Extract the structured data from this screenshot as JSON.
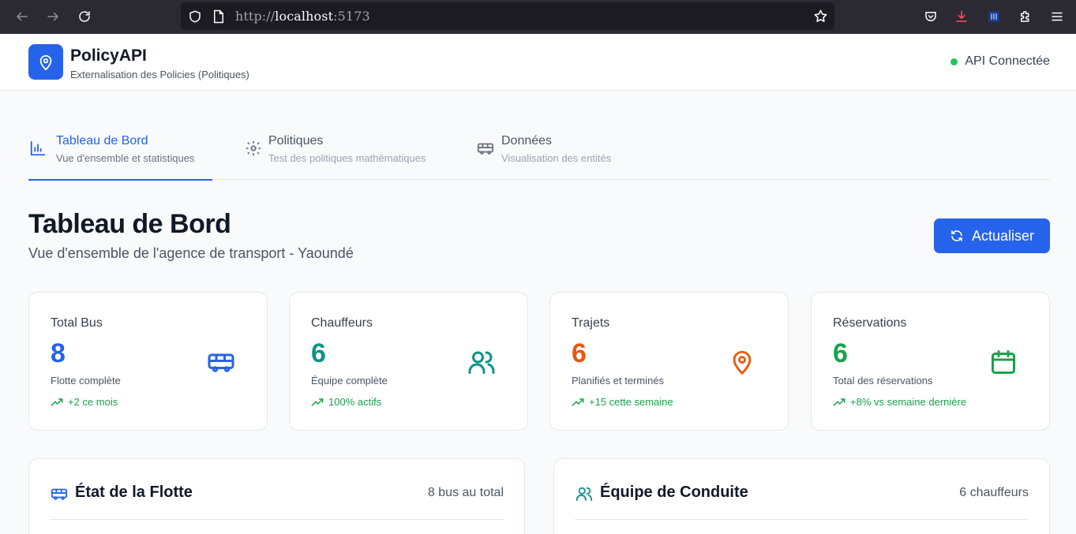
{
  "browser": {
    "url_scheme": "http://",
    "url_host": "localhost",
    "url_port": ":5173"
  },
  "header": {
    "title": "PolicyAPI",
    "subtitle": "Externalisation des Policies (Politiques)",
    "api_status": "API Connectée",
    "status_color": "#22c55e",
    "accent": "#2563eb"
  },
  "tabs": [
    {
      "label": "Tableau de Bord",
      "subtitle": "Vue d'ensemble et statistiques",
      "icon": "bar-chart-icon",
      "active": true
    },
    {
      "label": "Politiques",
      "subtitle": "Test des politiques mathématiques",
      "icon": "gear-icon",
      "active": false
    },
    {
      "label": "Données",
      "subtitle": "Visualisation des entités",
      "icon": "bus-icon",
      "active": false
    }
  ],
  "page": {
    "title": "Tableau de Bord",
    "subtitle": "Vue d'ensemble de l'agence de transport - Yaoundé",
    "refresh_label": "Actualiser"
  },
  "stats": [
    {
      "label": "Total Bus",
      "value": "8",
      "desc": "Flotte complète",
      "trend": "+2 ce mois",
      "color": "#2563eb",
      "icon": "bus-icon"
    },
    {
      "label": "Chauffeurs",
      "value": "6",
      "desc": "Équipe complète",
      "trend": "100% actifs",
      "color": "#0d9488",
      "icon": "users-icon"
    },
    {
      "label": "Trajets",
      "value": "6",
      "desc": "Planifiés et terminés",
      "trend": "+15 cette semaine",
      "color": "#ea580c",
      "icon": "map-pin-icon"
    },
    {
      "label": "Réservations",
      "value": "6",
      "desc": "Total des réservations",
      "trend": "+8% vs semaine dernière",
      "color": "#16a34a",
      "icon": "calendar-icon"
    }
  ],
  "panels": [
    {
      "title": "État de la Flotte",
      "meta": "8 bus au total",
      "icon": "bus-icon",
      "icon_color": "#2563eb"
    },
    {
      "title": "Équipe de Conduite",
      "meta": "6 chauffeurs",
      "icon": "users-icon",
      "icon_color": "#0d9488"
    }
  ]
}
